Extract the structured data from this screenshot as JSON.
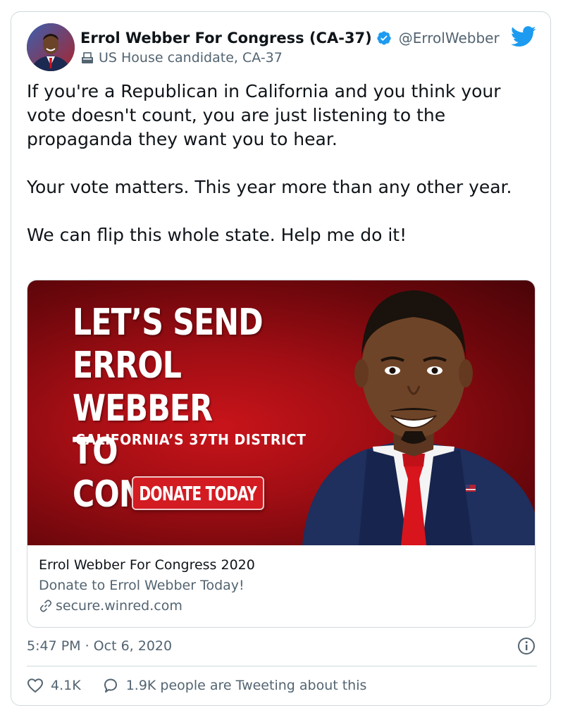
{
  "tweet": {
    "display_name": "Errol Webber For Congress (CA-37)",
    "handle": "@ErrolWebber",
    "label": "US House candidate, CA-37",
    "text": "If you're a Republican in California and you think your vote doesn't count, you are just listening to the propaganda they want you to hear.\n\nYour vote matters. This year more than any other year.\n\nWe can flip this whole state. Help me do it!",
    "timestamp": "5:47 PM · Oct 6, 2020"
  },
  "link_card": {
    "banner": {
      "headline_line1": "LET’S  SEND",
      "headline_line2": "ERROL WEBBER",
      "headline_line3": "TO  CONGRESS!",
      "subheadline": "CALIFORNIA’S 37TH DISTRICT",
      "donate_label": "DONATE TODAY"
    },
    "title": "Errol Webber For Congress 2020",
    "description": "Donate to Errol Webber Today!",
    "domain": "secure.winred.com"
  },
  "actions": {
    "likes": "4.1K",
    "conversation": "1.9K people are Tweeting about this"
  },
  "colors": {
    "twitter_blue": "#1d9bf0",
    "text_primary": "#0f1419",
    "text_secondary": "#536471",
    "banner_red": "#b0121a"
  },
  "icons": {
    "verified": "verified-badge-icon",
    "logo": "twitter-bird-icon",
    "label": "ballot-box-icon",
    "link": "link-icon",
    "info": "info-icon",
    "like": "heart-icon",
    "reply": "speech-bubble-icon"
  }
}
